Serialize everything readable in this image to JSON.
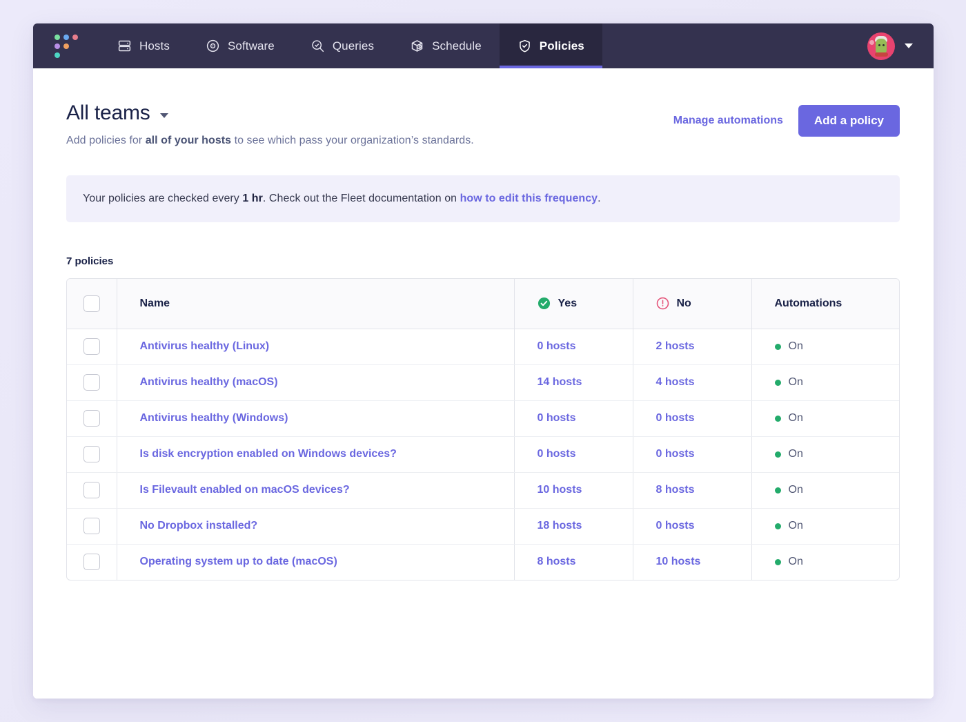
{
  "nav": {
    "logo_name": "fleet-logo",
    "items": [
      {
        "label": "Hosts",
        "icon": "server-icon",
        "active": false
      },
      {
        "label": "Software",
        "icon": "disc-icon",
        "active": false
      },
      {
        "label": "Queries",
        "icon": "search-check-icon",
        "active": false
      },
      {
        "label": "Schedule",
        "icon": "box-clock-icon",
        "active": false
      },
      {
        "label": "Policies",
        "icon": "shield-check-icon",
        "active": true
      }
    ],
    "user_menu_icon": "chevron-down-icon",
    "avatar_icon": "user-avatar"
  },
  "header": {
    "title": "All teams",
    "title_caret_icon": "chevron-down-icon",
    "subtitle_prefix": "Add policies for ",
    "subtitle_bold": "all of your hosts",
    "subtitle_suffix": " to see which pass your organization’s standards.",
    "manage_automations_label": "Manage automations",
    "add_policy_label": "Add a policy"
  },
  "banner": {
    "text_prefix": "Your policies are checked every ",
    "text_bold": "1 hr",
    "text_middle": ". Check out the Fleet documentation on ",
    "link_text": "how to edit this frequency",
    "text_suffix": "."
  },
  "table": {
    "count_label": "7 policies",
    "columns": {
      "name": "Name",
      "yes": "Yes",
      "no": "No",
      "automations": "Automations"
    },
    "yes_icon": "check-circle-icon",
    "no_icon": "alert-circle-icon",
    "select_all_checkbox": "select-all-checkbox",
    "rows": [
      {
        "name": "Antivirus healthy (Linux)",
        "yes": "0 hosts",
        "no": "2 hosts",
        "automation": "On"
      },
      {
        "name": "Antivirus healthy (macOS)",
        "yes": "14 hosts",
        "no": "4 hosts",
        "automation": "On"
      },
      {
        "name": "Antivirus healthy (Windows)",
        "yes": "0 hosts",
        "no": "0 hosts",
        "automation": "On"
      },
      {
        "name": "Is disk encryption enabled on Windows devices?",
        "yes": "0 hosts",
        "no": "0 hosts",
        "automation": "On"
      },
      {
        "name": "Is Filevault enabled on macOS devices?",
        "yes": "10 hosts",
        "no": "8 hosts",
        "automation": "On"
      },
      {
        "name": "No Dropbox installed?",
        "yes": "18 hosts",
        "no": "0 hosts",
        "automation": "On"
      },
      {
        "name": "Operating system up to date (macOS)",
        "yes": "8 hosts",
        "no": "10 hosts",
        "automation": "On"
      }
    ]
  },
  "colors": {
    "nav_bg": "#34324f",
    "nav_active_bg": "#29273f",
    "accent": "#6a67e0",
    "page_bg": "#eceafa",
    "banner_bg": "#f1f0fb",
    "yes_green": "#23ab6b",
    "no_red": "#e5567b",
    "status_green": "#23ab6b"
  }
}
